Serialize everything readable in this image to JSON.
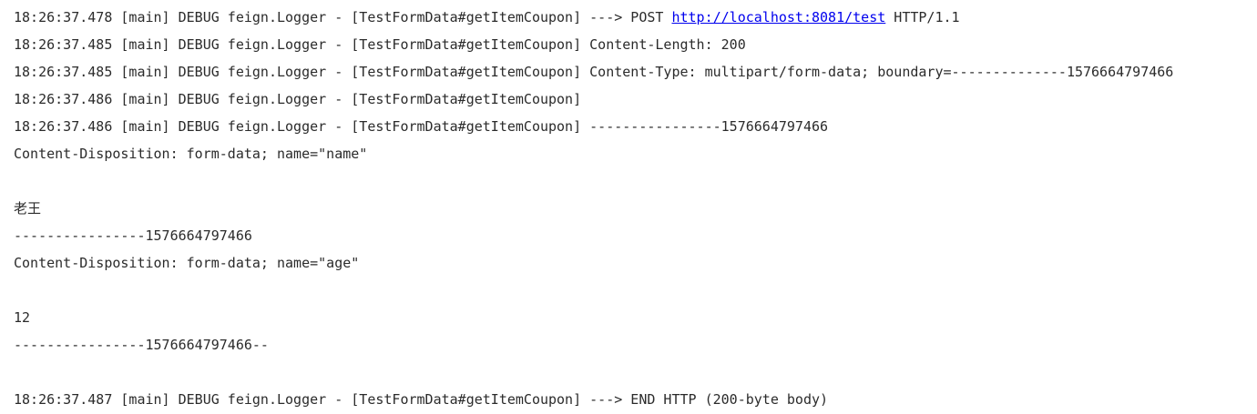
{
  "log": {
    "line1_prefix": "18:26:37.478 [main] DEBUG feign.Logger - [TestFormData#getItemCoupon] ---> POST ",
    "line1_url": "http://localhost:8081/test",
    "line1_suffix": " HTTP/1.1",
    "line2": "18:26:37.485 [main] DEBUG feign.Logger - [TestFormData#getItemCoupon] Content-Length: 200",
    "line3": "18:26:37.485 [main] DEBUG feign.Logger - [TestFormData#getItemCoupon] Content-Type: multipart/form-data; boundary=--------------1576664797466",
    "line4": "18:26:37.486 [main] DEBUG feign.Logger - [TestFormData#getItemCoupon]",
    "line5": "18:26:37.486 [main] DEBUG feign.Logger - [TestFormData#getItemCoupon] ----------------1576664797466",
    "line6": "Content-Disposition: form-data; name=\"name\"",
    "line7": "",
    "line8": "老王",
    "line9": "----------------1576664797466",
    "line10": "Content-Disposition: form-data; name=\"age\"",
    "line11": "",
    "line12": "12",
    "line13": "----------------1576664797466--",
    "line14": "",
    "line15": "18:26:37.487 [main] DEBUG feign.Logger - [TestFormData#getItemCoupon] ---> END HTTP (200-byte body)"
  }
}
